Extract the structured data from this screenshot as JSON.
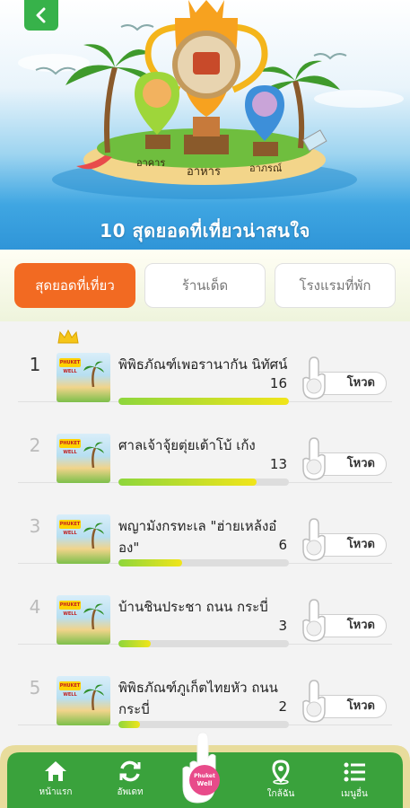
{
  "header": {
    "title": "10 สุดยอดที่เที่ยวน่าสนใจ",
    "trophy_labels": [
      "อาคาร",
      "อาหาร",
      "อาภรณ์"
    ]
  },
  "tabs": [
    {
      "label": "สุดยอดที่เที่ยว",
      "active": true
    },
    {
      "label": "ร้านเด็ด",
      "active": false
    },
    {
      "label": "โรงแรมที่พัก",
      "active": false
    }
  ],
  "list": {
    "vote_label": "โหวด",
    "max_votes": 16,
    "thumb_badge": "PHUKET WELL",
    "items": [
      {
        "rank": "1",
        "name": "พิพิธภัณฑ์เพอรานากัน นิทัศน์",
        "votes": 16
      },
      {
        "rank": "2",
        "name": "ศาลเจ้าจุ้ยตุ่ยเต้าโบ้ เก้ง",
        "votes": 13
      },
      {
        "rank": "3",
        "name": "พญามังกรทะเล \"ฮ่ายเหล้งอ๋อง\"",
        "votes": 6
      },
      {
        "rank": "4",
        "name": "บ้านชินประชา ถนน กระบี่",
        "votes": 3
      },
      {
        "rank": "5",
        "name": "พิพิธภัณฑ์ภูเก็ตไทยหัว ถนนกระบี่",
        "votes": 2
      }
    ]
  },
  "bottom_nav": {
    "items": [
      {
        "label": "หน้าแรก",
        "icon": "home-icon"
      },
      {
        "label": "อัพเดท",
        "icon": "refresh-icon"
      },
      {
        "label": "ใกล้ฉัน",
        "icon": "location-pin-icon"
      },
      {
        "label": "เมนูอื่น",
        "icon": "menu-list-icon"
      }
    ],
    "center_logo": "Phuket Well"
  },
  "colors": {
    "accent_orange": "#f26a22",
    "green": "#37b24a",
    "sky": "#2f95d8"
  }
}
